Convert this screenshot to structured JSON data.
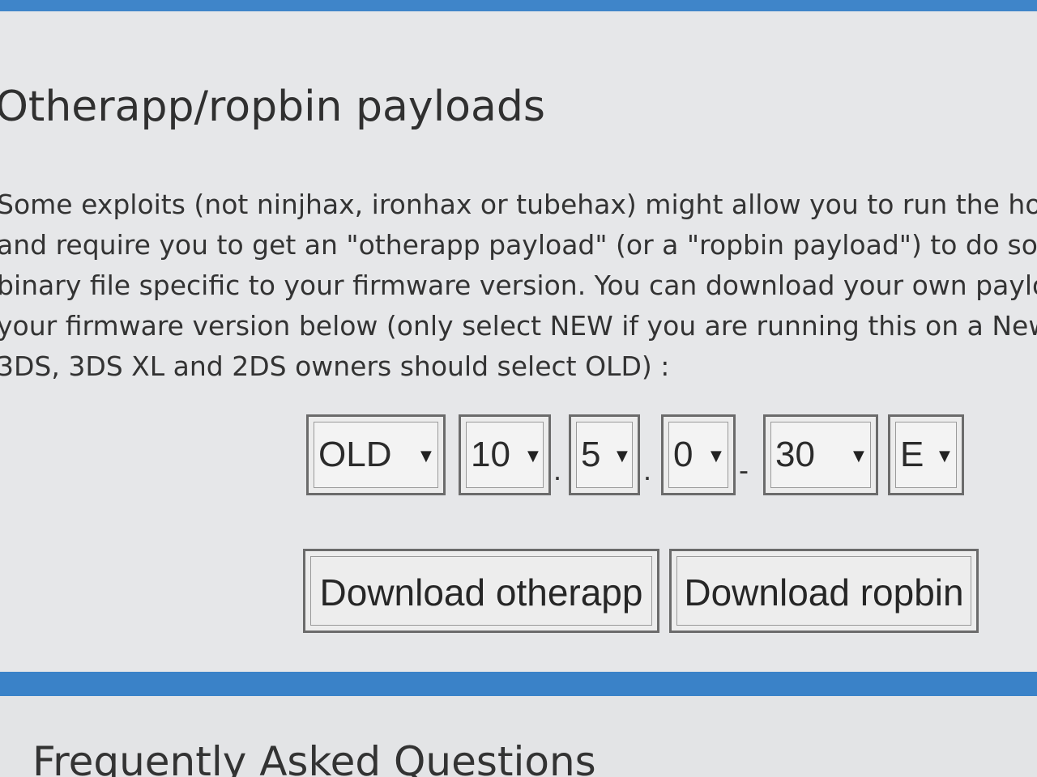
{
  "section": {
    "title": "Otherapp/ropbin payloads",
    "description_lines": [
      "Some exploits (not ninjhax, ironhax or tubehax) might allow you to run the hom",
      "and require you to get an \"otherapp payload\" (or a \"ropbin payload\") to do so.",
      "binary file specific to your firmware version. You can download your own paylo",
      "your firmware version below (only select NEW if you are running this on a New",
      "3DS, 3DS XL and 2DS owners should select OLD) :"
    ]
  },
  "firmware": {
    "model": "OLD",
    "major": "10",
    "minor": "5",
    "revision": "0",
    "nver": "30",
    "region": "E",
    "separators": [
      ".",
      ".",
      "-"
    ]
  },
  "buttons": {
    "otherapp": "Download otherapp",
    "ropbin": "Download ropbin"
  },
  "next_section": {
    "title": "Frequently Asked Questions"
  },
  "icons": {
    "dropdown": "chevron-down-icon"
  },
  "colors": {
    "accent": "#3a82c8",
    "panel": "#e6e7e9"
  }
}
